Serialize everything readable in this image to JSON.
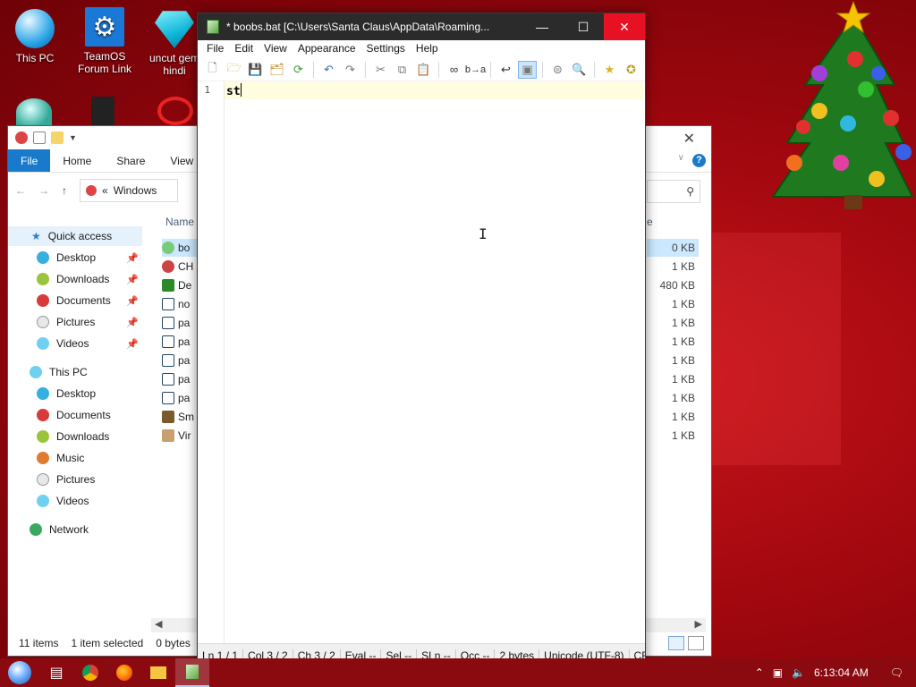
{
  "desktop": {
    "icons": [
      {
        "label": "This PC",
        "icon": "this-pc-icon"
      },
      {
        "label": "TeamOS Forum Link",
        "icon": "gear-icon"
      },
      {
        "label": "uncut gem hindi",
        "icon": "gem-icon"
      }
    ]
  },
  "explorer": {
    "ribbon_tabs": [
      "File",
      "Home",
      "Share",
      "View"
    ],
    "address": "Windows",
    "address_chevron": "«",
    "column_name": "Name",
    "column_size_fragment": "e",
    "nav": {
      "quick_access": "Quick access",
      "quick_items": [
        "Desktop",
        "Downloads",
        "Documents",
        "Pictures",
        "Videos"
      ],
      "this_pc": "This PC",
      "pc_items": [
        "Desktop",
        "Documents",
        "Downloads",
        "Music",
        "Pictures",
        "Videos"
      ],
      "network": "Network"
    },
    "files": [
      {
        "name": "bo",
        "size": "0 KB",
        "selected": true
      },
      {
        "name": "CH",
        "size": "1 KB"
      },
      {
        "name": "De",
        "size": "480 KB"
      },
      {
        "name": "no",
        "size": "1 KB"
      },
      {
        "name": "pa",
        "size": "1 KB"
      },
      {
        "name": "pa",
        "size": "1 KB"
      },
      {
        "name": "pa",
        "size": "1 KB"
      },
      {
        "name": "pa",
        "size": "1 KB"
      },
      {
        "name": "pa",
        "size": "1 KB"
      },
      {
        "name": "Sm",
        "size": "1 KB"
      },
      {
        "name": "Vir",
        "size": "1 KB"
      }
    ],
    "status": {
      "items": "11 items",
      "selected": "1 item selected",
      "bytes": "0 bytes"
    }
  },
  "notepad": {
    "title": "* boobs.bat [C:\\Users\\Santa Claus\\AppData\\Roaming...",
    "menu": [
      "File",
      "Edit",
      "View",
      "Appearance",
      "Settings",
      "Help"
    ],
    "line_number": "1",
    "content": "st",
    "status": {
      "ln": "Ln  1 / 1",
      "col": "Col  3 / 2",
      "ch": "Ch  3 / 2",
      "eval": "Eval  --",
      "sel": "Sel  --",
      "sln": "SLn  --",
      "occ": "Occ  --",
      "bytes": "2 bytes",
      "encoding": "Unicode (UTF-8)",
      "eol": "CR+"
    }
  },
  "taskbar": {
    "clock": "6:13:04 AM"
  },
  "colors": {
    "desktop_bg": "#a0070e",
    "accent": "#1979ca",
    "close_button": "#e81123",
    "current_line": "#fffde0",
    "taskbar": "#8a0a10"
  }
}
